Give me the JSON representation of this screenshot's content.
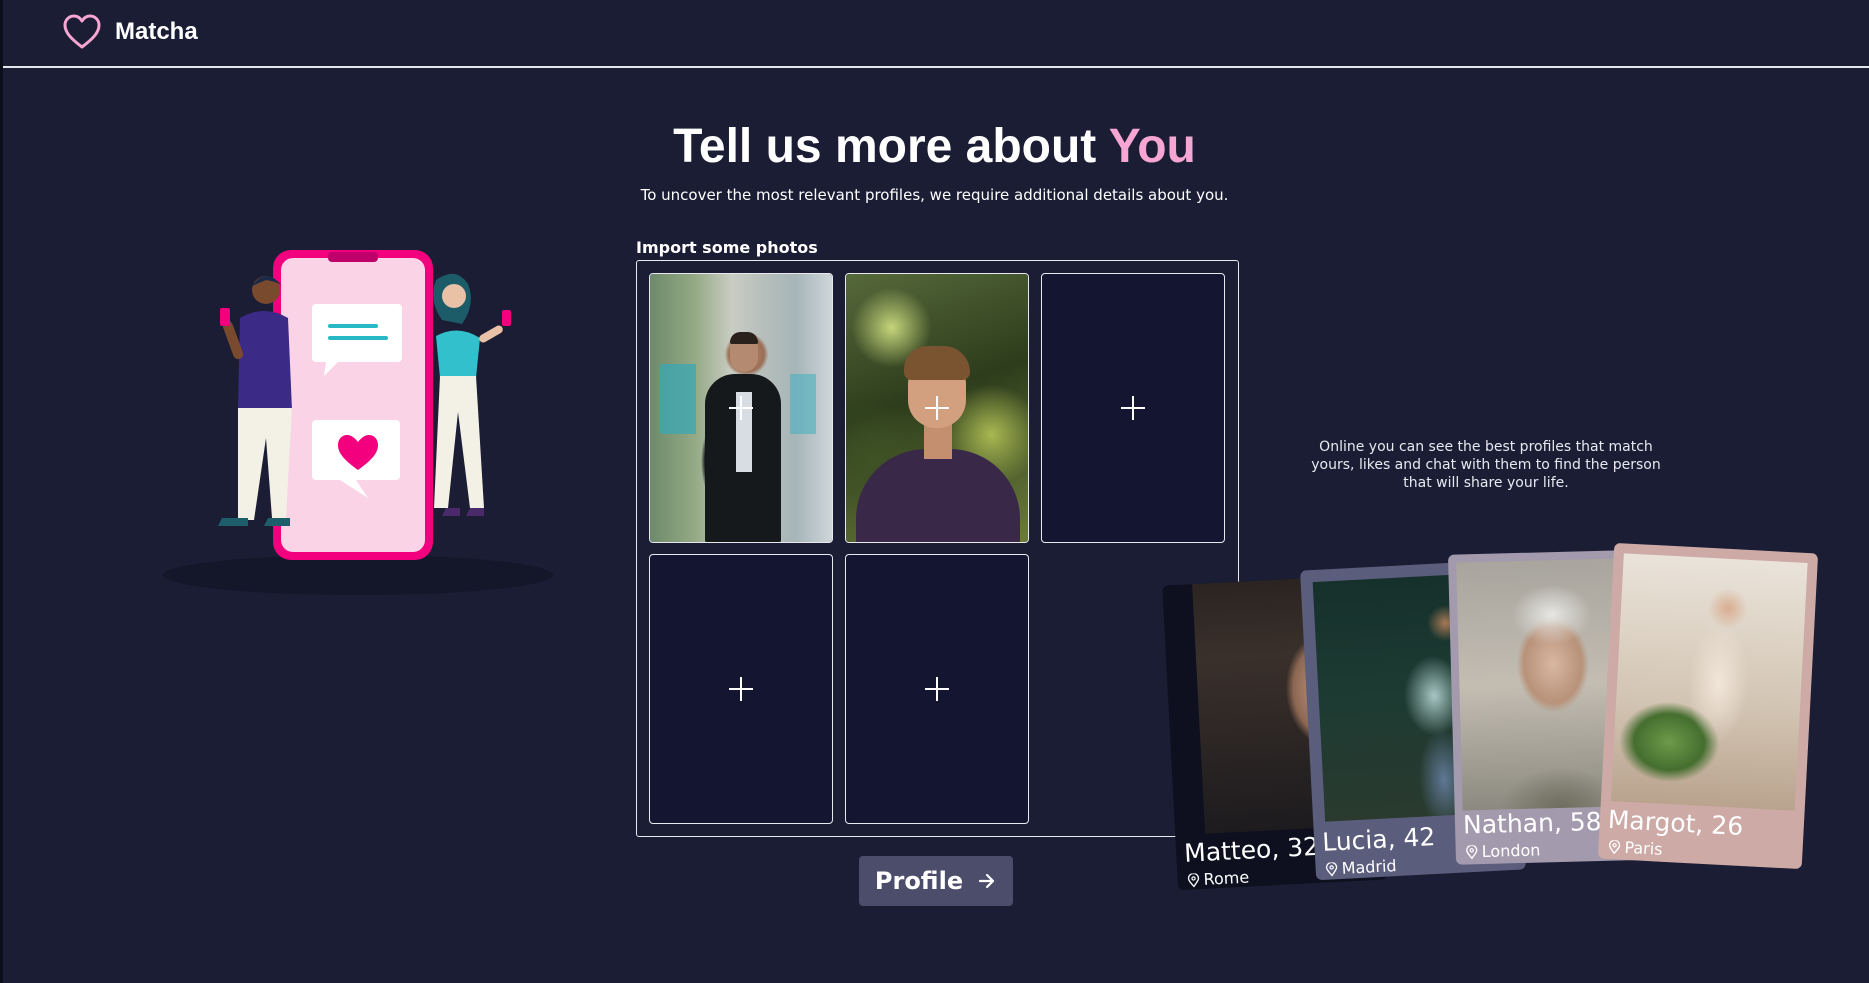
{
  "header": {
    "brand": "Matcha",
    "icon": "heart-outline-icon"
  },
  "hero": {
    "title_main": "Tell us more about ",
    "title_accent": "You",
    "subtitle": "To uncover the most relevant profiles, we require additional details about you."
  },
  "photos": {
    "label": "Import some photos",
    "slots": [
      {
        "filled": true
      },
      {
        "filled": true
      },
      {
        "filled": false
      },
      {
        "filled": false
      },
      {
        "filled": false
      }
    ]
  },
  "actions": {
    "profile_label": "Profile"
  },
  "promo": {
    "text": "Online you can see the best profiles that match yours, likes and chat with them to find the person that will share your life."
  },
  "cards": [
    {
      "name": "Matteo, 32",
      "city": "Rome"
    },
    {
      "name": "Lucia, 42",
      "city": "Madrid"
    },
    {
      "name": "Nathan, 58",
      "city": "London"
    },
    {
      "name": "Margot, 26",
      "city": "Paris"
    }
  ],
  "colors": {
    "background": "#1b1d35",
    "accent_pink": "#f7a6d3",
    "button": "#4b4d6b"
  }
}
